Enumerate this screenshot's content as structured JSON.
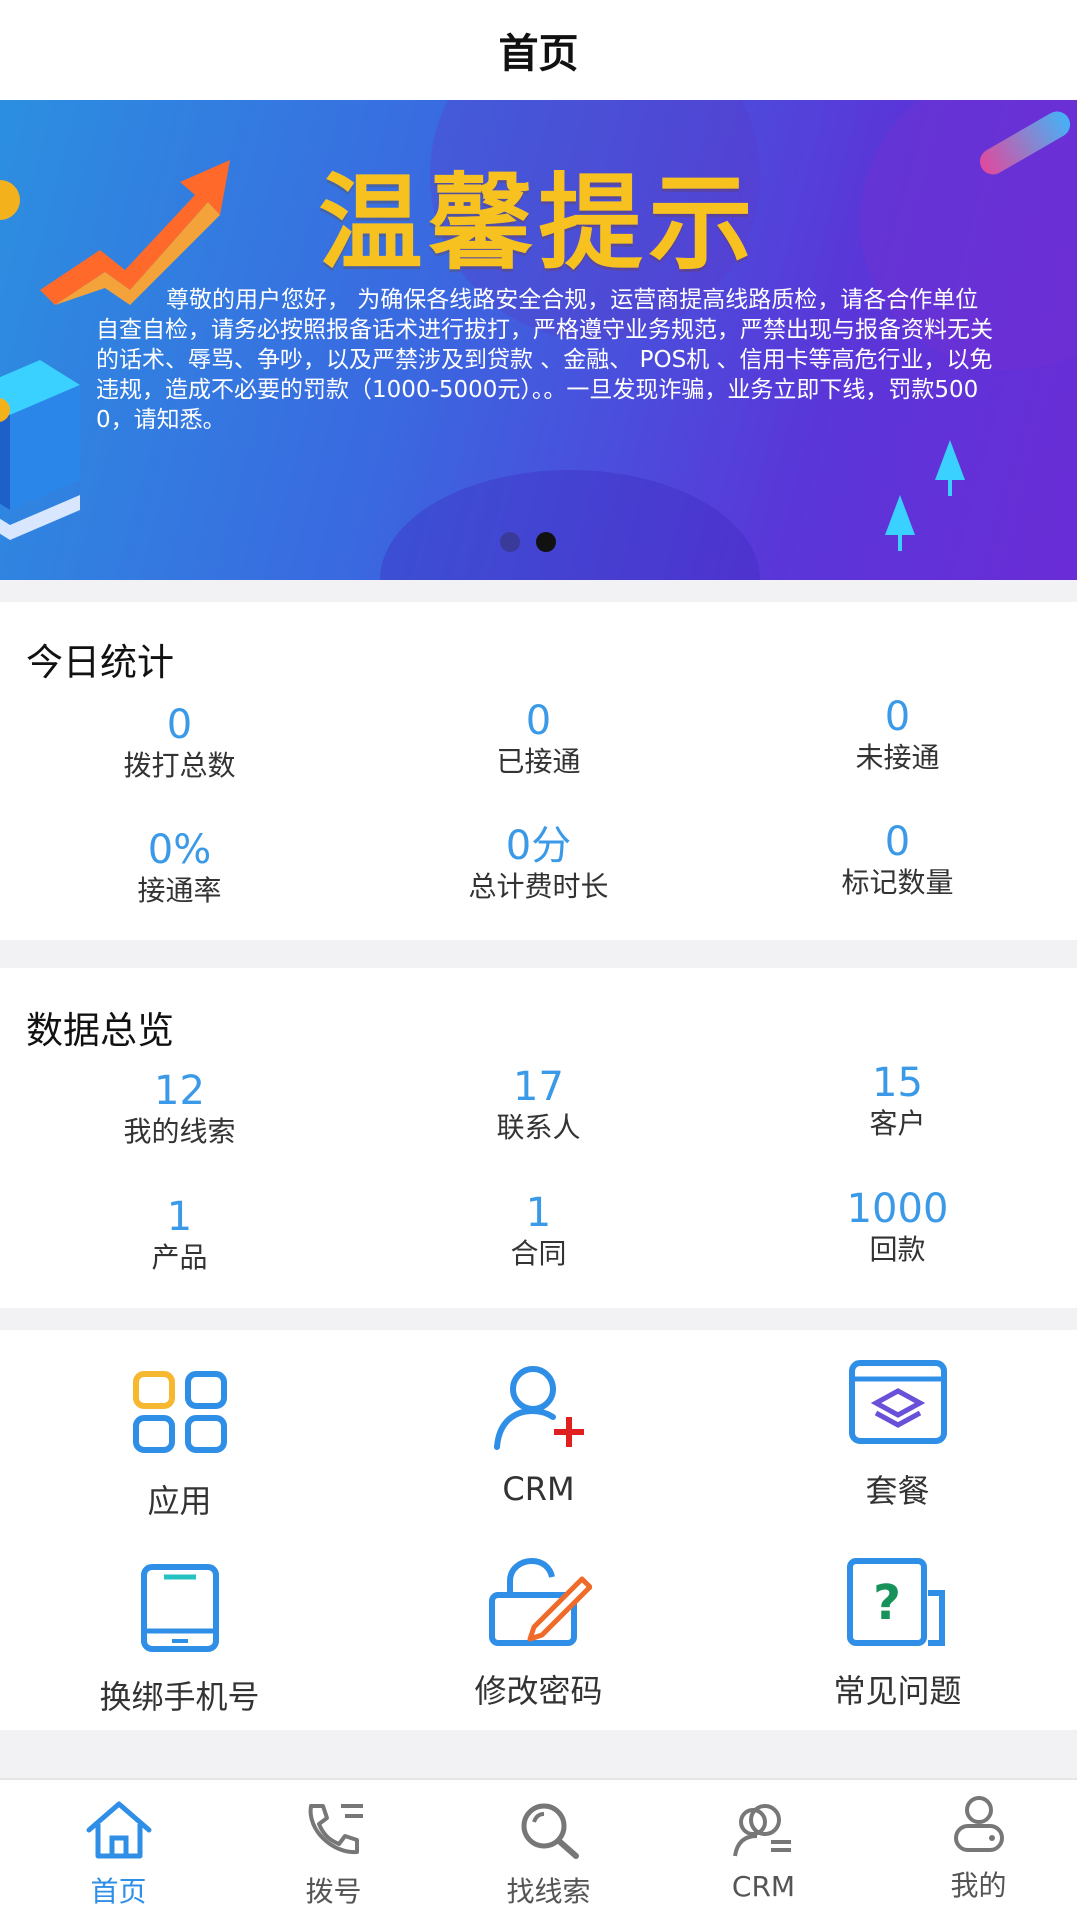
{
  "header": {
    "title": "首页"
  },
  "banner": {
    "title": "温馨提示",
    "notice": "尊敬的用户您好， 为确保各线路安全合规，运营商提高线路质检，请各合作单位自查自检，请务必按照报备话术进行拔打，严格遵守业务规范，严禁出现与报备资料无关的话术、辱骂、争吵，以及严禁涉及到贷款 、金融、 POS机 、信用卡等高危行业，以免违规，造成不必要的罚款（1000-5000元）。。一旦发现诈骗，业务立即下线，罚款5000，请知悉。",
    "slide_count": 2,
    "active_slide": 2
  },
  "today": {
    "title": "今日统计",
    "stats": [
      {
        "value": "0",
        "label": "拨打总数"
      },
      {
        "value": "0",
        "label": "已接通"
      },
      {
        "value": "0",
        "label": "未接通"
      },
      {
        "value": "0%",
        "label": "接通率"
      },
      {
        "value": "0分",
        "label": "总计费时长"
      },
      {
        "value": "0",
        "label": "标记数量"
      }
    ]
  },
  "overview": {
    "title": "数据总览",
    "stats": [
      {
        "value": "12",
        "label": "我的线索"
      },
      {
        "value": "17",
        "label": "联系人"
      },
      {
        "value": "15",
        "label": "客户"
      },
      {
        "value": "1",
        "label": "产品"
      },
      {
        "value": "1",
        "label": "合同"
      },
      {
        "value": "1000",
        "label": "回款"
      }
    ]
  },
  "shortcuts": [
    {
      "label": "应用",
      "icon": "apps-grid-icon"
    },
    {
      "label": "CRM",
      "icon": "add-user-icon"
    },
    {
      "label": "套餐",
      "icon": "package-layers-icon"
    },
    {
      "label": "换绑手机号",
      "icon": "phone-icon"
    },
    {
      "label": "修改密码",
      "icon": "lock-edit-icon"
    },
    {
      "label": "常见问题",
      "icon": "question-doc-icon"
    }
  ],
  "tabbar": [
    {
      "label": "首页",
      "icon": "home-icon",
      "active": true
    },
    {
      "label": "拨号",
      "icon": "dial-phone-icon",
      "active": false
    },
    {
      "label": "找线索",
      "icon": "search-icon",
      "active": false
    },
    {
      "label": "CRM",
      "icon": "crm-users-icon",
      "active": false
    },
    {
      "label": "我的",
      "icon": "profile-icon",
      "active": false
    }
  ],
  "colors": {
    "accent": "#3b9ae8",
    "tab_active": "#2f8fe6",
    "banner_title": "#f7c21f",
    "icon_blue": "#2f8fe6",
    "icon_yellow": "#f5b82e",
    "icon_red": "#e02020"
  }
}
